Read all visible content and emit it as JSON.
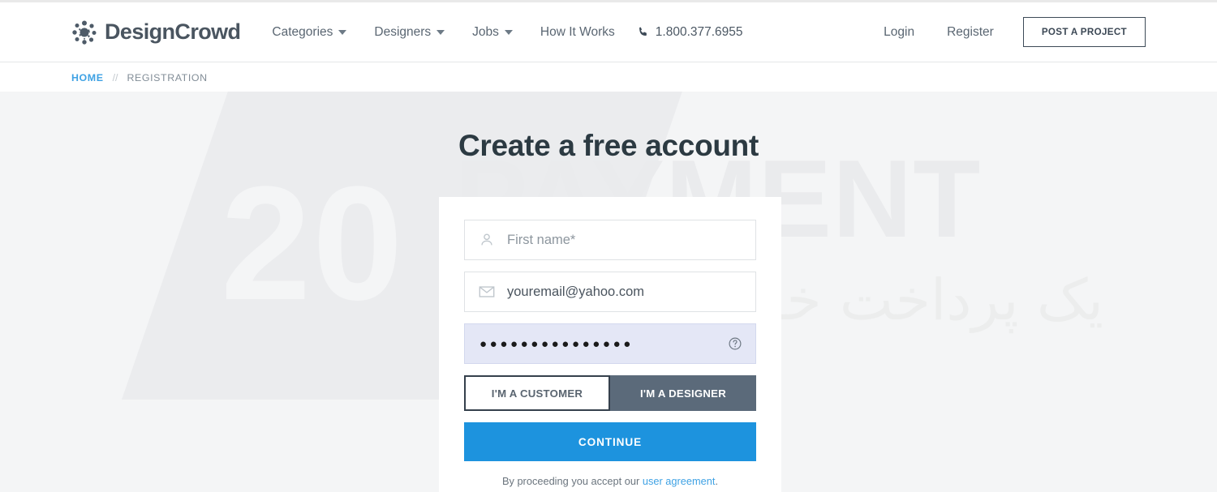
{
  "header": {
    "brand_name": "DesignCrowd",
    "brand_icon": "crowd-starburst-icon",
    "nav": [
      {
        "label": "Categories",
        "has_caret": true
      },
      {
        "label": "Designers",
        "has_caret": true
      },
      {
        "label": "Jobs",
        "has_caret": true
      },
      {
        "label": "How It Works",
        "has_caret": false
      }
    ],
    "phone": {
      "icon": "phone-icon",
      "number": "1.800.377.6955"
    },
    "login_label": "Login",
    "register_label": "Register",
    "post_project_label": "POST A PROJECT"
  },
  "breadcrumb": {
    "home_label": "HOME",
    "separator": "//",
    "current_label": "REGISTRATION"
  },
  "watermark": {
    "number": "20",
    "word": "PAYMENT",
    "farsi": "یک پرداخت خوب"
  },
  "page": {
    "title": "Create a free account"
  },
  "form": {
    "first_name": {
      "icon": "user-icon",
      "placeholder": "First name*",
      "value": ""
    },
    "email": {
      "icon": "envelope-icon",
      "placeholder": "youremail@yahoo.com",
      "value": "youremail@yahoo.com"
    },
    "password": {
      "masked_value": "●●●●●●●●●●●●●●●",
      "help_icon": "question-circle-icon"
    },
    "roles": [
      {
        "label": "I'M A CUSTOMER",
        "selected": false
      },
      {
        "label": "I'M A DESIGNER",
        "selected": true
      }
    ],
    "continue_label": "CONTINUE",
    "terms_prefix": "By proceeding you accept our ",
    "terms_link": "user agreement",
    "terms_suffix": "."
  },
  "colors": {
    "accent_blue": "#1d93de",
    "link_blue": "#3fa2e4",
    "slate": "#5b6a7a",
    "dark": "#35404c",
    "page_bg": "#f4f5f6",
    "password_autofill": "#e4e7f6"
  }
}
